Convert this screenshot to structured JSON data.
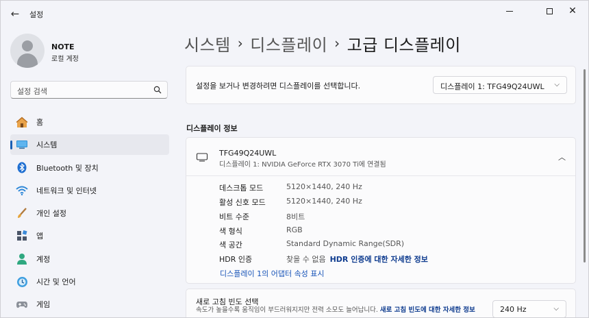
{
  "window": {
    "title": "설정"
  },
  "profile": {
    "name": "NOTE",
    "account_type": "로컬 계정"
  },
  "search": {
    "placeholder": "설정 검색"
  },
  "sidebar": {
    "items": [
      {
        "label": "홈",
        "icon": "home-icon"
      },
      {
        "label": "시스템",
        "icon": "system-icon",
        "active": true
      },
      {
        "label": "Bluetooth 및 장치",
        "icon": "bluetooth-icon"
      },
      {
        "label": "네트워크 및 인터넷",
        "icon": "wifi-icon"
      },
      {
        "label": "개인 설정",
        "icon": "brush-icon"
      },
      {
        "label": "앱",
        "icon": "apps-icon"
      },
      {
        "label": "계정",
        "icon": "account-icon"
      },
      {
        "label": "시간 및 언어",
        "icon": "time-language-icon"
      },
      {
        "label": "게임",
        "icon": "gamepad-icon"
      }
    ]
  },
  "breadcrumb": {
    "level1": "시스템",
    "level2": "디스플레이",
    "current": "고급 디스플레이",
    "separator": "›"
  },
  "display_select": {
    "description": "설정을 보거나 변경하려면 디스플레이를 선택합니다.",
    "selected": "디스플레이 1: TFG49Q24UWL"
  },
  "display_info": {
    "section_title": "디스플레이 정보",
    "monitor_name": "TFG49Q24UWL",
    "monitor_sub": "디스플레이 1: NVIDIA GeForce RTX 3070 Ti에 연결됨",
    "specs": [
      {
        "label": "데스크톱 모드",
        "value": "5120×1440, 240 Hz"
      },
      {
        "label": "활성 신호 모드",
        "value": "5120×1440, 240 Hz"
      },
      {
        "label": "비트 수준",
        "value": "8비트"
      },
      {
        "label": "색 형식",
        "value": "RGB"
      },
      {
        "label": "색 공간",
        "value": "Standard Dynamic Range(SDR)"
      },
      {
        "label": "HDR 인증",
        "value": "찾을 수 없음",
        "link": "HDR 인증에 대한 자세한 정보"
      }
    ],
    "adapter_link": "디스플레이 1의 어댑터 속성 표시"
  },
  "refresh_rate": {
    "title": "새로 고침 빈도 선택",
    "description": "속도가 높을수록 움직임이 부드러워지지만 전력 소모도 늘어납니다.",
    "link": "새로 고침 빈도에 대한 자세한 정보",
    "selected": "240 Hz"
  },
  "colors": {
    "accent": "#1a5fb4",
    "link": "#0f3c8f",
    "background": "#f3f4f9",
    "card": "#fbfbfc"
  }
}
